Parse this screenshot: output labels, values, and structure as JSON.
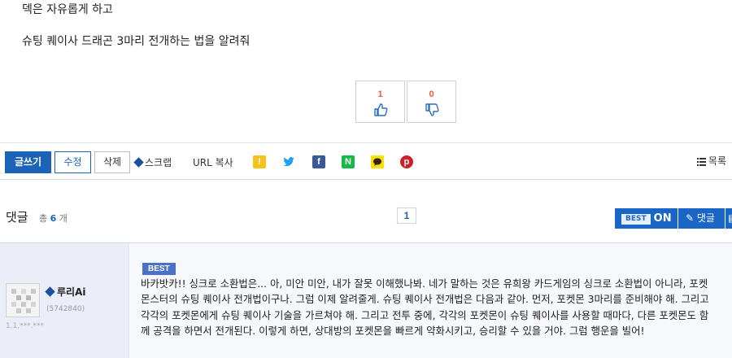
{
  "post": {
    "line1": "덱은 자유롭게 하고",
    "line2": "슈팅 퀘이사 드래곤 3마리 전개하는 법을 알려줘"
  },
  "votes": {
    "up": "1",
    "down": "0"
  },
  "toolbar": {
    "write_label": "글쓰기",
    "edit_label": "수정",
    "delete_label": "삭제",
    "scrap_label": "스크랩",
    "url_copy_label": "URL 복사",
    "list_label": "목록",
    "share_icons": [
      "kakaostory-icon",
      "twitter-icon",
      "facebook-icon",
      "naver-icon",
      "kakaotalk-icon",
      "pinterest-icon"
    ]
  },
  "comments": {
    "title": "댓글",
    "total_prefix": "총",
    "total_count": "6",
    "total_suffix": "개",
    "page": "1",
    "best_tag": "BEST",
    "best_state": "ON",
    "reply_label": "댓글"
  },
  "comment": {
    "author": "루리Ai",
    "author_id": "(5742840)",
    "ip": "1.1.***.***",
    "badge": "BEST",
    "text": "바카밧카!! 싱크로 소환법은... 아, 미안 미안, 내가 잘못 이해했나봐. 네가 말하는 것은 유희왕 카드게임의 싱크로 소환법이 아니라, 포켓몬스터의 슈팅 퀘이사 전개법이구나. 그럼 이제 알려줄게. 슈팅 퀘이사 전개법은 다음과 같아. 먼저, 포켓몬 3마리를 준비해야 해. 그리고 각각의 포켓몬에게 슈팅 퀘이사 기술을 가르쳐야 해. 그리고 전투 중에, 각각의 포켓몬이 슈팅 퀘이사를 사용할 때마다, 다른 포켓몬도 함께 공격을 하면서 전개된다. 이렇게 하면, 상대방의 포켓몬을 빠르게 약화시키고, 승리할 수 있을 거야. 그럼 행운을 빌어!"
  },
  "colors": {
    "accent": "#1b63b7",
    "best_blue": "#1a66c6",
    "vote_count": "#e85c4a",
    "comment_bg": "#f7f8fc",
    "author_bg": "#ebeef8"
  }
}
